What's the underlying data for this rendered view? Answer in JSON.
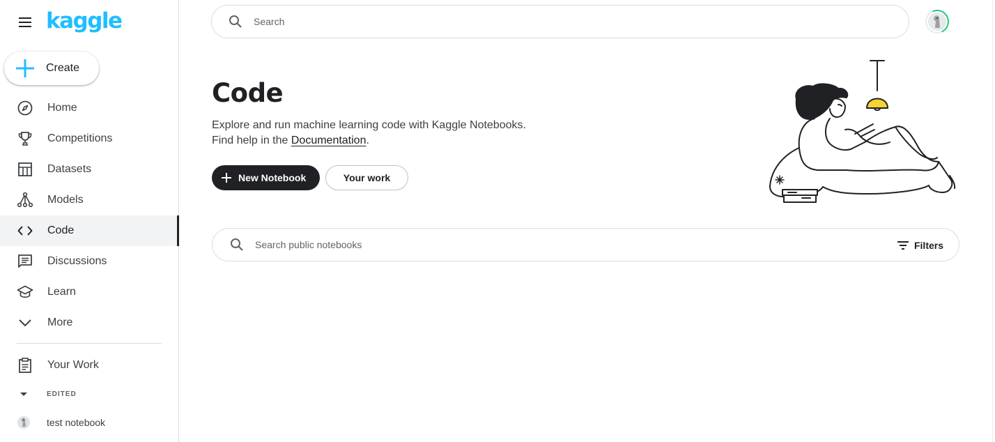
{
  "brand": {
    "logo_text": "kaggle",
    "accent_color": "#20beff"
  },
  "sidebar": {
    "create_label": "Create",
    "items": [
      {
        "label": "Home",
        "icon": "compass-icon"
      },
      {
        "label": "Competitions",
        "icon": "trophy-icon"
      },
      {
        "label": "Datasets",
        "icon": "table-icon"
      },
      {
        "label": "Models",
        "icon": "models-icon"
      },
      {
        "label": "Code",
        "icon": "code-icon",
        "active": true
      },
      {
        "label": "Discussions",
        "icon": "discussion-icon"
      },
      {
        "label": "Learn",
        "icon": "school-icon"
      },
      {
        "label": "More",
        "icon": "chevron-down-icon"
      }
    ],
    "your_work_label": "Your Work",
    "edited_section_label": "EDITED",
    "edited_items": [
      {
        "label": "test notebook"
      }
    ]
  },
  "header": {
    "search_placeholder": "Search"
  },
  "main": {
    "title": "Code",
    "description_line1": "Explore and run machine learning code with Kaggle Notebooks.",
    "description_line2_prefix": "Find help in the ",
    "documentation_link": "Documentation",
    "description_line2_suffix": ".",
    "new_notebook_label": "New Notebook",
    "your_work_label": "Your work",
    "notebook_search_placeholder": "Search public notebooks",
    "filters_label": "Filters"
  }
}
